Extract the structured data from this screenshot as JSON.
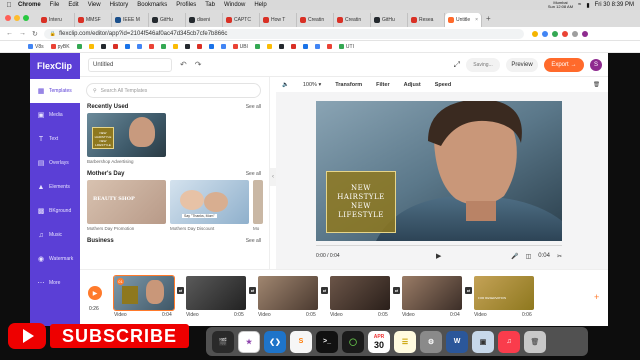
{
  "menubar": {
    "items": [
      "Chrome",
      "File",
      "Edit",
      "View",
      "History",
      "Bookmarks",
      "Profiles",
      "Tab",
      "Window",
      "Help"
    ],
    "city": "Mumbai",
    "city_time": "Sun 12:08 AM",
    "datetime": "Fri 30 8:39 PM"
  },
  "tabs": [
    {
      "label": "Interu",
      "color": "#d93025"
    },
    {
      "label": "MMSF",
      "color": "#d93025"
    },
    {
      "label": "IEEE M",
      "color": "#1a4f8b"
    },
    {
      "label": "GitHu",
      "color": "#24292e"
    },
    {
      "label": "diseni",
      "color": "#24292e"
    },
    {
      "label": "CAPTC",
      "color": "#d93025"
    },
    {
      "label": "How T",
      "color": "#d93025"
    },
    {
      "label": "Creatin",
      "color": "#d93025"
    },
    {
      "label": "Creatin",
      "color": "#d93025"
    },
    {
      "label": "GitHu",
      "color": "#24292e"
    },
    {
      "label": "Resea",
      "color": "#d93025"
    },
    {
      "label": "Untitle",
      "color": "#ff6a2b",
      "active": true
    }
  ],
  "address": {
    "url": "flexclip.com/editor/app?id=2104f546af0ac47d345cb7cfe7b866c"
  },
  "bookmarks": [
    "V8s",
    "pyBK",
    "",
    "",
    "",
    "",
    "",
    "",
    "",
    "",
    "",
    "",
    "",
    "",
    "",
    "UBI",
    "",
    "",
    "",
    "",
    "",
    "",
    "",
    "UTI"
  ],
  "app": {
    "logo": "FlexClip",
    "nav": [
      "Templates",
      "Media",
      "Text",
      "Overlays",
      "Elements",
      "BKground",
      "Music",
      "Watermark",
      "More"
    ],
    "project_title": "Untitled",
    "saving": "Saving...",
    "preview": "Preview",
    "export": "Export",
    "avatar": "S"
  },
  "panel": {
    "search_placeholder": "Search All Templates",
    "sections": [
      {
        "title": "Recently Used",
        "see_all": "See all",
        "items": [
          {
            "caption": "Barbershop Advertising"
          }
        ]
      },
      {
        "title": "Mother's Day",
        "see_all": "See all",
        "items": [
          {
            "caption": "Mothers Day Promotion",
            "overlay": "BEAUTY SHOP"
          },
          {
            "caption": "Mothers Day Discount",
            "overlay": "Say \"Thanks, Mom\""
          },
          {
            "caption": "Mo"
          }
        ]
      },
      {
        "title": "Business",
        "see_all": "See all",
        "items": []
      }
    ],
    "recent_overlay": "NEW HAIRSTYLE NEW LIFESTYLE"
  },
  "editor": {
    "zoom": "100%",
    "tools": [
      "Transform",
      "Filter",
      "Adjust",
      "Speed"
    ],
    "overlay_lines": [
      "NEW",
      "HAIRSTYLE",
      "NEW",
      "LIFESTYLE"
    ],
    "time": "0:00 / 0:04",
    "duration": "0:04"
  },
  "timeline": {
    "current": "0:26",
    "clips": [
      {
        "label": "Video",
        "duration": "0:04",
        "num": "01"
      },
      {
        "label": "Video",
        "duration": "0:05",
        "num": ""
      },
      {
        "label": "Video",
        "duration": "0:05",
        "num": ""
      },
      {
        "label": "Video",
        "duration": "0:05",
        "num": ""
      },
      {
        "label": "Video",
        "duration": "0:04",
        "num": ""
      },
      {
        "label": "Video",
        "duration": "0:06",
        "num": ""
      }
    ],
    "last_clip_text": "FOR RESERVATION"
  },
  "overlays": {
    "subscribe": "SUBSCRIBE"
  },
  "dock": {
    "calendar_month": "APR",
    "calendar_day": "30"
  },
  "colors": {
    "brand": "#5b3fd6",
    "accent": "#ff6a2b",
    "gold": "#8e781e"
  }
}
